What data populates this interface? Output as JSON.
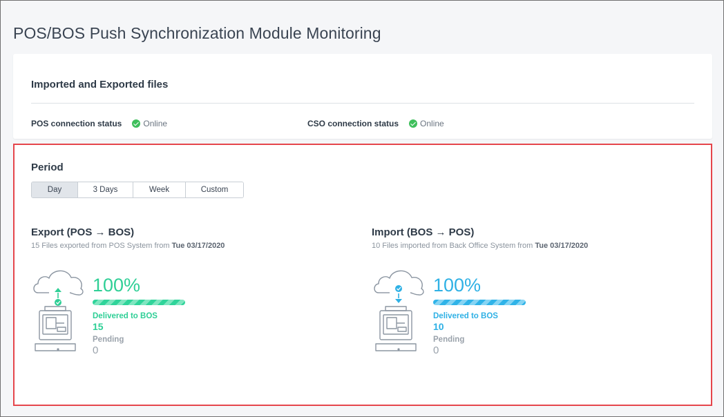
{
  "page_title": "POS/BOS Push Synchronization Module Monitoring",
  "summary": {
    "title": "Imported and Exported files",
    "pos_status": {
      "label": "POS connection status",
      "value": "Online"
    },
    "cso_status": {
      "label": "CSO connection status",
      "value": "Online"
    }
  },
  "period": {
    "title": "Period",
    "options": [
      "Day",
      "3 Days",
      "Week",
      "Custom"
    ],
    "selected": "Day"
  },
  "export": {
    "title": "Export (POS → BOS)",
    "subtitle_prefix": "15 Files exported from POS System from ",
    "subtitle_date": "Tue 03/17/2020",
    "percent": "100%",
    "progress": 1.0,
    "delivered_label": "Delivered to BOS",
    "delivered_value": "15",
    "pending_label": "Pending",
    "pending_value": "0",
    "accent_color": "#2fcf96",
    "icon": "cloud-upload-to-pos-terminal-icon"
  },
  "import": {
    "title": "Import (BOS → POS)",
    "subtitle_prefix": "10 Files imported from Back Office System from ",
    "subtitle_date": "Tue 03/17/2020",
    "percent": "100%",
    "progress": 1.0,
    "delivered_label": "Delivered to BOS",
    "delivered_value": "10",
    "pending_label": "Pending",
    "pending_value": "0",
    "accent_color": "#2fb1e5",
    "icon": "cloud-download-to-pos-terminal-icon"
  },
  "colors": {
    "online": "#3fbf5c",
    "highlight_border": "#e5454b"
  }
}
